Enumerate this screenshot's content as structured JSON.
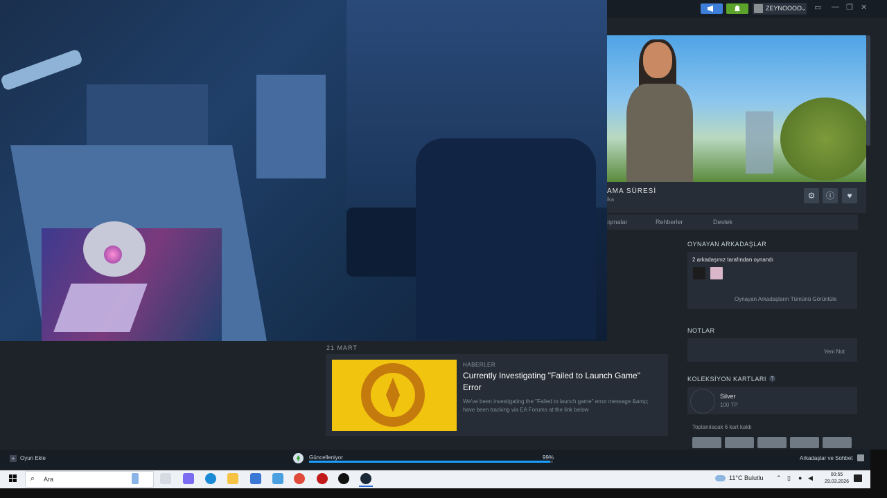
{
  "topbar": {
    "username": "ZEYNOOOO",
    "announce_color": "#3d7ed8",
    "notify_color": "#5ba32b",
    "window_controls": [
      "minimize-icon",
      "maximize-icon",
      "close-icon"
    ]
  },
  "game_header": {
    "playtime_label": "AMA SÜRESİ",
    "playtime_sub": "ika"
  },
  "tabs": [
    "ışmalar",
    "Rehberler",
    "Destek"
  ],
  "news": {
    "date": "21 MART",
    "kicker": "HABERLER",
    "title": "Currently Investigating \"Failed to Launch Game\" Error",
    "description": "We've been investigating the \"Failed to launch game\" error message &amp; have been tracking via EA Forums at the link below"
  },
  "friends_playing": {
    "heading": "OYNAYAN ARKADAŞLAR",
    "summary": "2 arkadaşınız tarafından oynandı",
    "view_all": "Oynayan Arkadaşların Tümünü Görüntüle"
  },
  "notes": {
    "heading": "NOTLAR",
    "new_note": "Yeni Not"
  },
  "cards": {
    "heading": "KOLEKSİYON KARTLARI",
    "help": "?",
    "badge_name": "Silver",
    "badge_xp": "100 TP",
    "remaining": "Toplanılacak 6 kart kaldı"
  },
  "bottombar": {
    "add_game": "Oyun Ekle",
    "updating": "Güncelleniyor",
    "progress_pct": 99,
    "progress_label": "99%",
    "friends_chat": "Arkadaşlar ve Sohbet"
  },
  "taskbar": {
    "search_placeholder": "Ara",
    "weather": "11°C  Bulutlu",
    "time": "00:55",
    "date": "29.03.2026"
  }
}
